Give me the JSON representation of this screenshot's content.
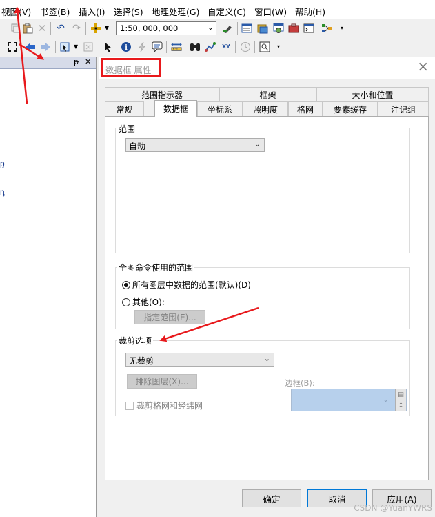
{
  "menubar": {
    "items": [
      "视图(V)",
      "书签(B)",
      "插入(I)",
      "选择(S)",
      "地理处理(G)",
      "自定义(C)",
      "窗口(W)",
      "帮助(H)"
    ]
  },
  "toolbar": {
    "scale_value": "1:50, 000, 000",
    "icons": [
      "paste-icon",
      "delete-icon",
      "undo-icon",
      "redo-icon",
      "add-data-icon",
      "editor-icon",
      "table-window-icon",
      "catalog-icon",
      "search-window-icon",
      "arctoolbox-icon",
      "python-icon",
      "model-builder-icon",
      "full-extent-icon",
      "back-icon",
      "forward-icon",
      "select-features-icon",
      "clear-selection-icon",
      "select-elements-icon",
      "identify-icon",
      "hyperlink-icon",
      "html-popup-icon",
      "measure-icon",
      "find-icon",
      "find-route-icon",
      "go-to-xy-icon",
      "time-slider-icon",
      "create-viewer-icon"
    ],
    "xy_label": "XY"
  },
  "left_panel": {
    "pin_glyph": "ᵽ",
    "close_glyph": "✕",
    "cut_text_1": "ᶈ",
    "cut_text_2": "ᶇ"
  },
  "dialog": {
    "title": "数据框 属性",
    "tabs_row1": [
      "范围指示器",
      "框架",
      "大小和位置"
    ],
    "tabs_row2": [
      "常规",
      "数据框",
      "坐标系",
      "照明度",
      "格网",
      "要素缓存",
      "注记组"
    ],
    "active_tab": "数据框",
    "extent_group": {
      "title": "范围",
      "combo_value": "自动"
    },
    "full_extent_group": {
      "title": "全图命令使用的范围",
      "option_all_layers": "所有图层中数据的范围(默认)(D)",
      "option_other": "其他(O):",
      "specify_extent_button": "指定范围(E)..."
    },
    "clip_group": {
      "title": "裁剪选项",
      "combo_value": "无裁剪",
      "exclude_layers_button": "排除图层(X)...",
      "border_label": "边框(B):",
      "clip_graticule_checkbox": "裁剪格网和经纬网"
    },
    "buttons": {
      "ok": "确定",
      "cancel": "取消",
      "apply": "应用(A)"
    }
  },
  "watermark": "CSDN @YuanYWRS",
  "colors": {
    "annotation_red": "#e8191c",
    "border_combo_fill": "#b7d0ec"
  }
}
